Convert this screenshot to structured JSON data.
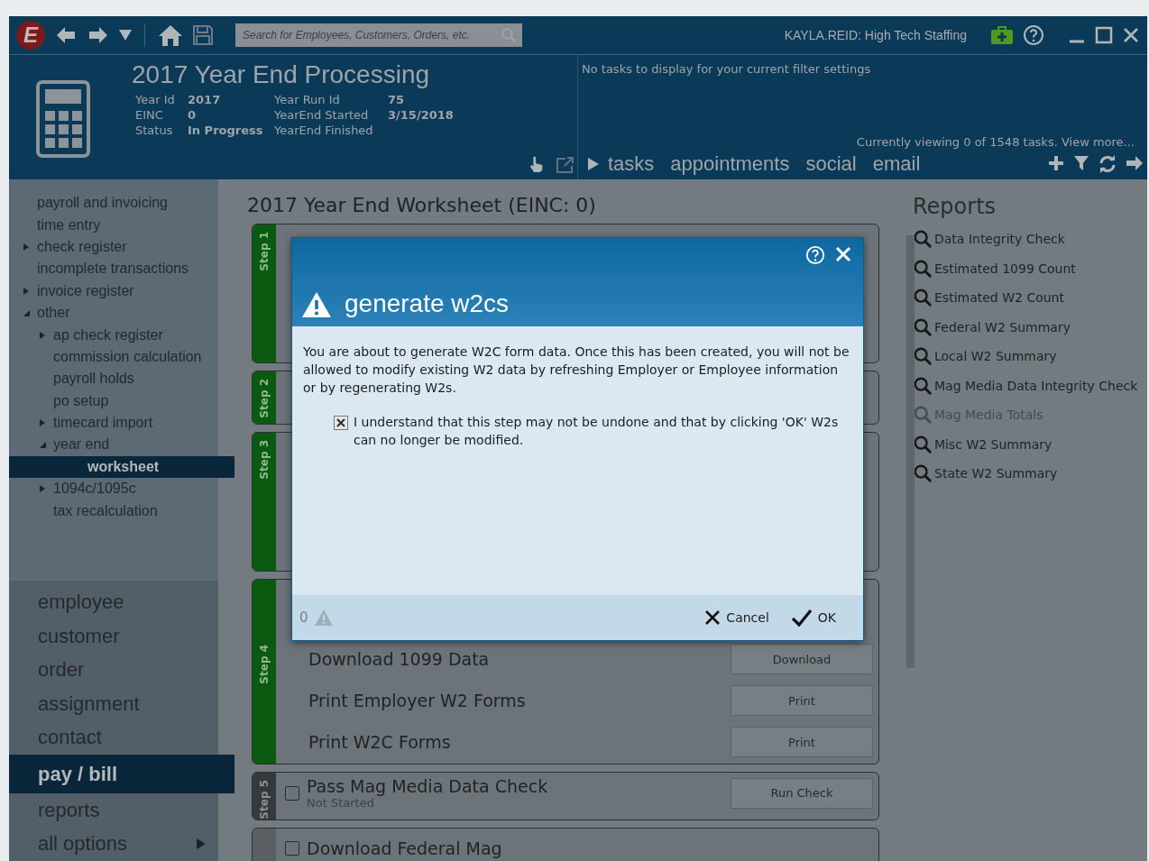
{
  "top_bar": {
    "logo_text": "E",
    "search": {
      "placeholder": "Search for Employees, Customers, Orders, etc."
    },
    "user": "KAYLA.REID: High Tech Staffing"
  },
  "header": {
    "title": "2017 Year End Processing",
    "fields": [
      {
        "label": "Year Id",
        "value": "2017"
      },
      {
        "label": "Year Run Id",
        "value": "75"
      },
      {
        "label": "EINC",
        "value": "0"
      },
      {
        "label": "YearEnd Started",
        "value": "3/15/2018"
      },
      {
        "label": "Status",
        "value": "In Progress"
      },
      {
        "label": "YearEnd Finished"
      }
    ]
  },
  "tasks_panel": {
    "message": "No tasks to display for your current filter settings",
    "viewing": "Currently viewing 0 of 1548 tasks. View more...",
    "tabs": [
      "tasks",
      "appointments",
      "social",
      "email"
    ]
  },
  "sidebar": {
    "tree": [
      {
        "label": "payroll and invoicing",
        "selected": false
      },
      {
        "label": "time entry",
        "selected": false
      },
      {
        "label": "check register",
        "selected": false,
        "expanded": false
      },
      {
        "label": "incomplete transactions",
        "selected": false
      },
      {
        "label": "invoice register",
        "selected": false,
        "expanded": false
      },
      {
        "label": "other",
        "selected": false,
        "expanded": true,
        "children": [
          {
            "label": "ap check register",
            "selected": false,
            "expanded": false
          },
          {
            "label": "commission calculation",
            "selected": false
          },
          {
            "label": "payroll holds",
            "selected": false
          },
          {
            "label": "po setup",
            "selected": false
          },
          {
            "label": "timecard import",
            "selected": false,
            "expanded": false
          },
          {
            "label": "year end",
            "selected": false,
            "expanded": true,
            "children": [
              {
                "label": "worksheet",
                "selected": true
              }
            ]
          },
          {
            "label": "1094c/1095c",
            "selected": false,
            "expanded": false
          },
          {
            "label": "tax recalculation",
            "selected": false
          }
        ]
      }
    ],
    "nav": [
      {
        "label": "employee",
        "selected": false
      },
      {
        "label": "customer",
        "selected": false
      },
      {
        "label": "order",
        "selected": false
      },
      {
        "label": "assignment",
        "selected": false
      },
      {
        "label": "contact",
        "selected": false
      },
      {
        "label": "pay / bill",
        "selected": true
      },
      {
        "label": "reports",
        "selected": false
      },
      {
        "label": "all options",
        "selected": false,
        "submenu": true
      }
    ]
  },
  "worksheet": {
    "title": "2017 Year End Worksheet (EINC: 0)",
    "steps": [
      {
        "label": "Step 1",
        "color": "#0b5a12"
      },
      {
        "label": "Step 2",
        "color": "#0b5a12"
      },
      {
        "label": "Step 3",
        "color": "#0b5a12"
      },
      {
        "label": "Step 4",
        "color": "#0b5a12",
        "tasks": [
          {
            "title": "Download 1099 Data",
            "button": "Download"
          },
          {
            "title": "Print Employer W2 Forms",
            "button": "Print"
          },
          {
            "title": "Print W2C Forms",
            "button": "Print"
          }
        ]
      },
      {
        "label": "Step 5",
        "color": "#35393c",
        "tasks": [
          {
            "title": "Pass Mag Media Data Check",
            "status": "Not Started",
            "checked": false,
            "button": "Run Check"
          }
        ]
      },
      {
        "color": "#5a5f63",
        "tasks": [
          {
            "title": "Download Federal Mag",
            "checked": false
          }
        ]
      }
    ]
  },
  "reports": {
    "title": "Reports",
    "items": [
      {
        "label": "Data Integrity Check",
        "disabled": false
      },
      {
        "label": "Estimated 1099 Count",
        "disabled": false
      },
      {
        "label": "Estimated W2 Count",
        "disabled": false
      },
      {
        "label": "Federal W2 Summary",
        "disabled": false
      },
      {
        "label": "Local W2 Summary",
        "disabled": false
      },
      {
        "label": "Mag Media Data Integrity Check",
        "disabled": false
      },
      {
        "label": "Mag Media Totals",
        "disabled": true
      },
      {
        "label": "Misc W2 Summary",
        "disabled": false
      },
      {
        "label": "State W2 Summary",
        "disabled": false
      }
    ]
  },
  "dialog": {
    "title": "generate w2cs",
    "message": "You are about to generate W2C form data. Once this has been created, you will not be allowed to modify existing W2 data by refreshing Employer or Employee information or by regenerating W2s.",
    "confirm": {
      "label": "I understand that this step may not be undone and that by clicking 'OK' W2s can no longer be modified.",
      "checked": true
    },
    "warning_count": "0",
    "buttons": [
      "Cancel",
      "OK"
    ]
  }
}
